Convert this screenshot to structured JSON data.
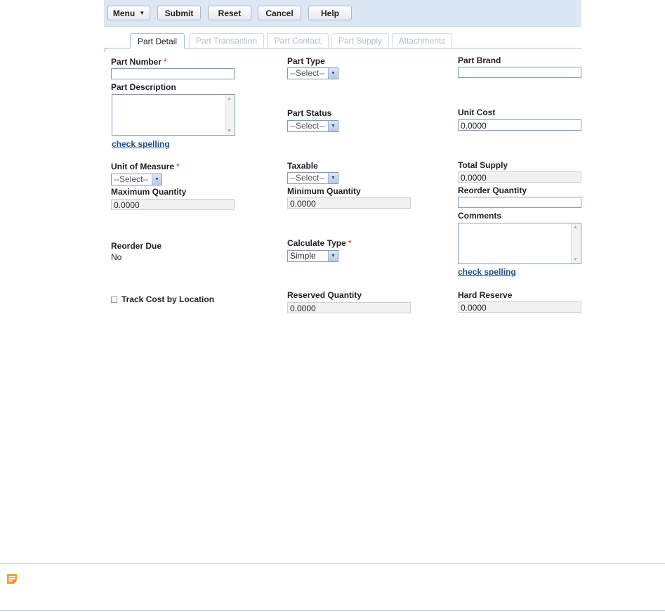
{
  "toolbar": {
    "menu_label": "Menu",
    "submit_label": "Submit",
    "reset_label": "Reset",
    "cancel_label": "Cancel",
    "help_label": "Help"
  },
  "tabs": [
    {
      "label": "Part Detail",
      "active": true
    },
    {
      "label": "Part Transaction",
      "active": false
    },
    {
      "label": "Part Contact",
      "active": false
    },
    {
      "label": "Part Supply",
      "active": false
    },
    {
      "label": "Attachments",
      "active": false
    }
  ],
  "form": {
    "part_number": {
      "label": "Part Number",
      "required": "*",
      "value": ""
    },
    "part_type": {
      "label": "Part Type",
      "value": "--Select--"
    },
    "part_brand": {
      "label": "Part Brand",
      "value": ""
    },
    "part_description": {
      "label": "Part Description",
      "value": "",
      "spell_link": "check spelling"
    },
    "part_status": {
      "label": "Part Status",
      "value": "--Select--"
    },
    "unit_cost": {
      "label": "Unit Cost",
      "value": "0.0000"
    },
    "unit_of_measure": {
      "label": "Unit of Measure",
      "required": "*",
      "value": "--Select--"
    },
    "taxable": {
      "label": "Taxable",
      "value": "--Select--"
    },
    "total_supply": {
      "label": "Total Supply",
      "value": "0.0000"
    },
    "maximum_quantity": {
      "label": "Maximum Quantity",
      "value": "0.0000"
    },
    "minimum_quantity": {
      "label": "Minimum Quantity",
      "value": "0.0000"
    },
    "reorder_quantity": {
      "label": "Reorder Quantity",
      "value": ""
    },
    "comments": {
      "label": "Comments",
      "value": "",
      "spell_link": "check spelling"
    },
    "reorder_due": {
      "label": "Reorder Due",
      "value": "No"
    },
    "calculate_type": {
      "label": "Calculate Type",
      "required": "*",
      "value": "Simple"
    },
    "track_cost": {
      "label": "Track Cost by Location",
      "checked": false
    },
    "reserved_quantity": {
      "label": "Reserved Quantity",
      "value": "0.0000"
    },
    "hard_reserve": {
      "label": "Hard Reserve",
      "value": "0.0000"
    }
  },
  "icons": {
    "menu_caret": "caret-down-icon",
    "select_arrow": "chevron-down-icon",
    "note": "note-icon"
  },
  "colors": {
    "toolbar_bg": "#dbe7f5",
    "link": "#1d4f8c",
    "required": "#dd2222",
    "note_icon": "#f5a623"
  }
}
